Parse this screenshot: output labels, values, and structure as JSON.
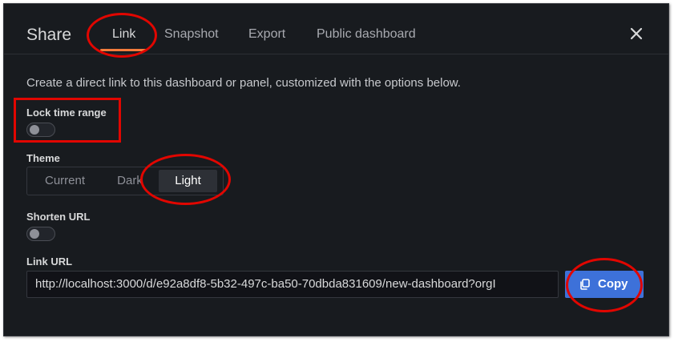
{
  "modal": {
    "title": "Share",
    "tabs": [
      {
        "label": "Link",
        "active": true
      },
      {
        "label": "Snapshot",
        "active": false
      },
      {
        "label": "Export",
        "active": false
      },
      {
        "label": "Public dashboard",
        "active": false
      }
    ],
    "close_icon": "close-icon"
  },
  "description": "Create a direct link to this dashboard or panel, customized with the options below.",
  "lock_time_range": {
    "label": "Lock time range",
    "enabled": false
  },
  "theme": {
    "label": "Theme",
    "options": [
      "Current",
      "Dark",
      "Light"
    ],
    "selected": "Light"
  },
  "shorten_url": {
    "label": "Shorten URL",
    "enabled": false
  },
  "link_url": {
    "label": "Link URL",
    "value": "http://localhost:3000/d/e92a8df8-5b32-497c-ba50-70dbda831609/new-dashboard?orgI"
  },
  "copy_button": {
    "label": "Copy",
    "icon": "copy-icon"
  },
  "colors": {
    "background": "#181b1f",
    "active_tab_underline": "#f47c3c",
    "primary_button": "#3d71d9",
    "annotation": "#e10600"
  }
}
